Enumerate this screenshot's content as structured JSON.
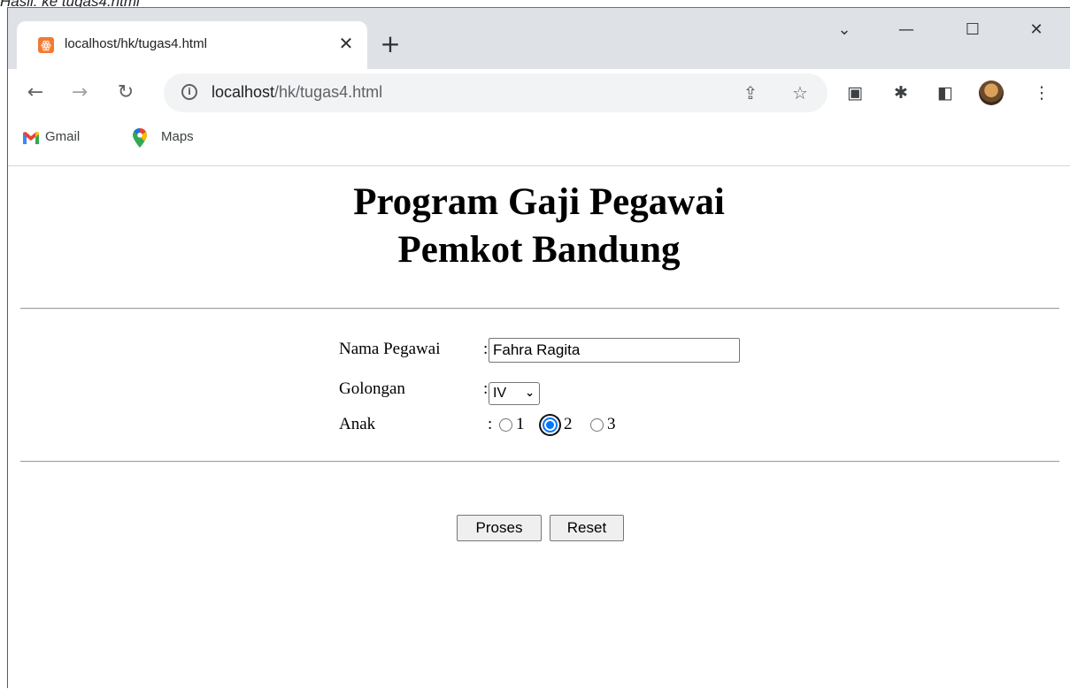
{
  "top_caption": "Hasil: ke tugas4.html",
  "browser": {
    "tab_title": "localhost/hk/tugas4.html",
    "url_host": "localhost",
    "url_path": "/hk/tugas4.html",
    "bookmarks": [
      {
        "label": "Gmail"
      },
      {
        "label": "Maps"
      }
    ]
  },
  "page": {
    "title_line1": "Program Gaji Pegawai",
    "title_line2": "Pemkot Bandung",
    "form": {
      "name_label": "Nama Pegawai",
      "name_value": "Fahra Ragita",
      "golongan_label": "Golongan",
      "golongan_value": "IV",
      "anak_label": "Anak",
      "colon": ":",
      "anak_options": [
        "1",
        "2",
        "3"
      ],
      "anak_selected": "2"
    },
    "buttons": {
      "submit_label": "Proses",
      "reset_label": "Reset"
    }
  },
  "colors": {
    "accent": "#0075ff",
    "tabstrip": "#dee1e6"
  }
}
